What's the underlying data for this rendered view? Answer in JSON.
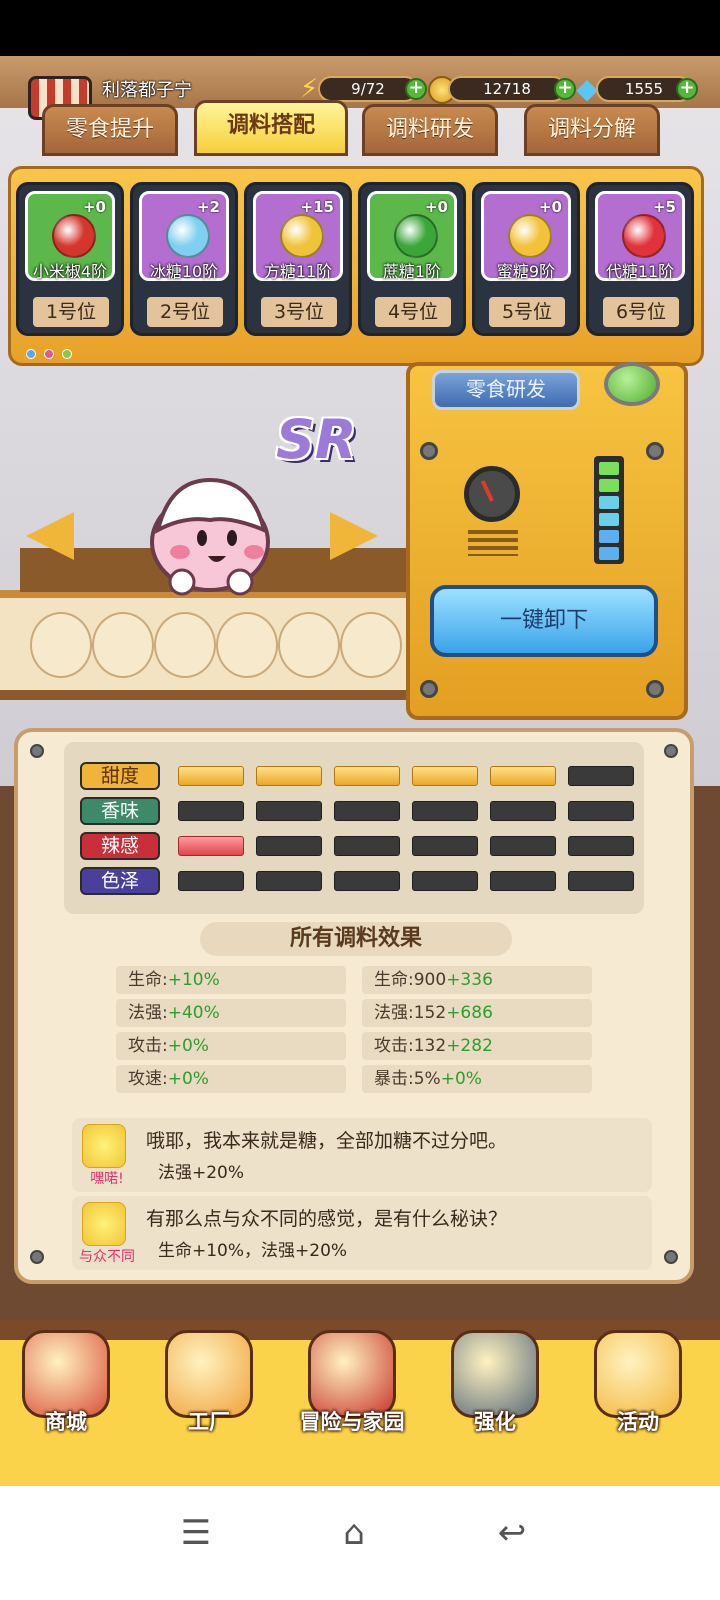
{
  "player": {
    "name": "利落都子宁"
  },
  "resources": {
    "energy": "9/72",
    "coins": "12718",
    "diamonds": "1555"
  },
  "tabs": [
    {
      "label": "零食提升"
    },
    {
      "label": "调料搭配"
    },
    {
      "label": "调料研发"
    },
    {
      "label": "调料分解"
    }
  ],
  "slots": [
    {
      "name": "小米椒4阶",
      "level": "+0",
      "position": "1号位",
      "color": "#5cb84a",
      "gem": "#d4352c"
    },
    {
      "name": "冰糖10阶",
      "level": "+2",
      "position": "2号位",
      "color": "#b36ed0",
      "gem": "#7fd0f0"
    },
    {
      "name": "方糖11阶",
      "level": "+15",
      "position": "3号位",
      "color": "#b36ed0",
      "gem": "#f0c43a"
    },
    {
      "name": "蔗糖1阶",
      "level": "+0",
      "position": "4号位",
      "color": "#5cb84a",
      "gem": "#3da63a"
    },
    {
      "name": "蜜糖9阶",
      "level": "+0",
      "position": "5号位",
      "color": "#b36ed0",
      "gem": "#f3c23a"
    },
    {
      "name": "代糖11阶",
      "level": "+5",
      "position": "6号位",
      "color": "#b36ed0",
      "gem": "#e0333a"
    }
  ],
  "character": {
    "rarity": "SR"
  },
  "machine": {
    "research_label": "零食研发",
    "unload_label": "一键卸下"
  },
  "stats": [
    {
      "label": "甜度",
      "color": "#f0b43a",
      "filled": 5,
      "type": "sweet"
    },
    {
      "label": "香味",
      "color": "#3c8a6a",
      "filled": 0,
      "type": "none"
    },
    {
      "label": "辣感",
      "color": "#c92f3a",
      "filled": 1,
      "type": "spicy"
    },
    {
      "label": "色泽",
      "color": "#4a3f9a",
      "filled": 0,
      "type": "none"
    }
  ],
  "effects_title": "所有调料效果",
  "effects_left": [
    {
      "label": "生命:",
      "value": "+10%"
    },
    {
      "label": "法强:",
      "value": "+40%"
    },
    {
      "label": "攻击:",
      "value": "+0%"
    },
    {
      "label": "攻速:",
      "value": "+0%"
    }
  ],
  "effects_right": [
    {
      "label": "生命:",
      "base": "900",
      "value": "+336"
    },
    {
      "label": "法强:",
      "base": "152",
      "value": "+686"
    },
    {
      "label": "攻击:",
      "base": "132",
      "value": "+282"
    },
    {
      "label": "暴击:",
      "base": "5%",
      "value": "+0%"
    }
  ],
  "bonds": [
    {
      "tag": "嘿喏!",
      "text": "哦耶，我本来就是糖，全部加糖不过分吧。",
      "bonus": "法强+20%"
    },
    {
      "tag": "与众不同",
      "text": "有那么点与众不同的感觉，是有什么秘诀？",
      "bonus": "生命+10%，法强+20%"
    }
  ],
  "bottom_nav": [
    {
      "label": "商城",
      "color": "#d9503a"
    },
    {
      "label": "工厂",
      "color": "#f0a13a"
    },
    {
      "label": "冒险与家园",
      "color": "#c7352c"
    },
    {
      "label": "强化",
      "color": "#5a6b7a"
    },
    {
      "label": "活动",
      "color": "#f3b53a"
    }
  ],
  "system_nav": {
    "menu": "☰",
    "home": "⌂",
    "back": "↩"
  }
}
